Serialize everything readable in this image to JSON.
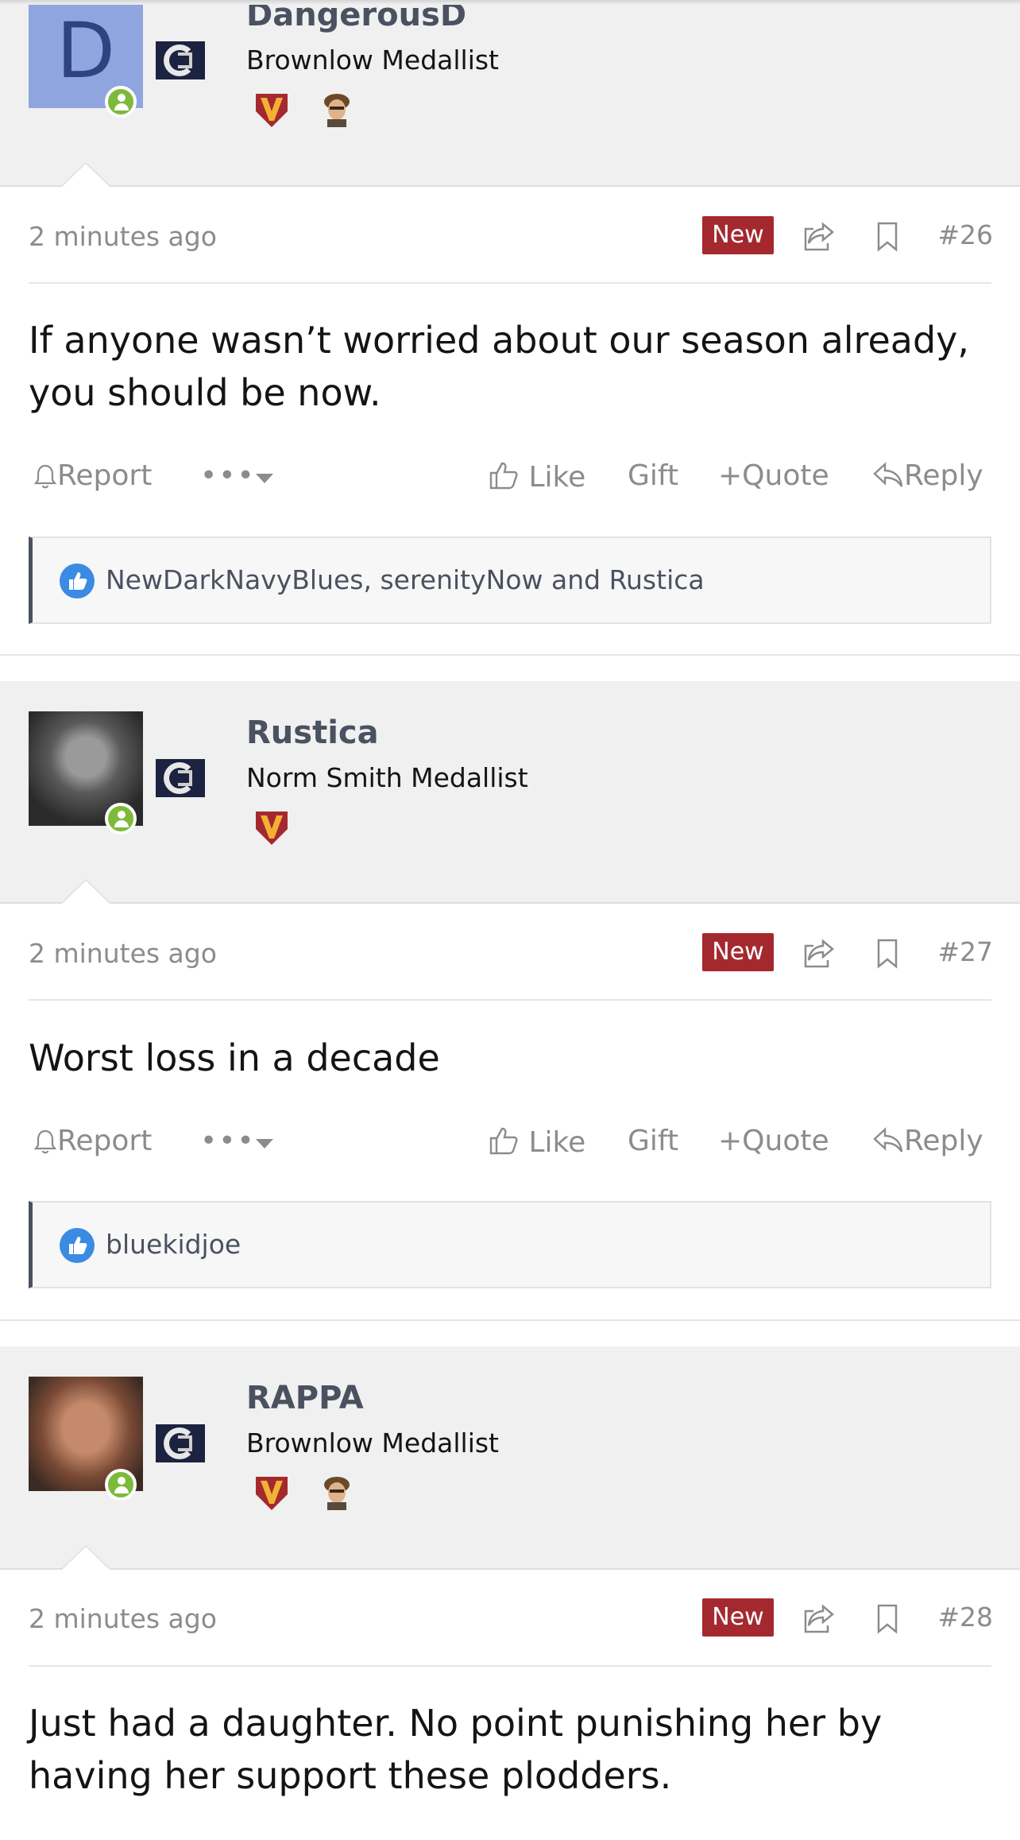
{
  "posts": [
    {
      "username": "DangerousD",
      "avatar_letter": "D",
      "user_title": "Brownlow Medallist",
      "badges": [
        "v-trophy-icon",
        "helmet-head-icon"
      ],
      "timestamp": "2 minutes ago",
      "new_label": "New",
      "post_number": "#26",
      "message": "If anyone wasn’t worried about our season already, you should be now.",
      "reactions_text": "NewDarkNavyBlues, serenityNow and Rustica"
    },
    {
      "username": "Rustica",
      "user_title": "Norm Smith Medallist",
      "badges": [
        "v-trophy-icon"
      ],
      "timestamp": "2 minutes ago",
      "new_label": "New",
      "post_number": "#27",
      "message": "Worst loss in a decade",
      "reactions_text": "bluekidjoe"
    },
    {
      "username": "RAPPA",
      "user_title": "Brownlow Medallist",
      "badges": [
        "v-trophy-icon",
        "helmet-head-icon"
      ],
      "timestamp": "2 minutes ago",
      "new_label": "New",
      "post_number": "#28",
      "message": "Just had a daughter. No point punishing her by having her support these plodders."
    }
  ],
  "actions": {
    "report": "Report",
    "more": "•••",
    "like": "Like",
    "gift": "Gift",
    "quote": "Quote",
    "reply": "Reply"
  },
  "colors": {
    "new_badge": "#a4292f",
    "online": "#7eba3a",
    "like_blue": "#3b8be3",
    "username": "#4a5160"
  }
}
